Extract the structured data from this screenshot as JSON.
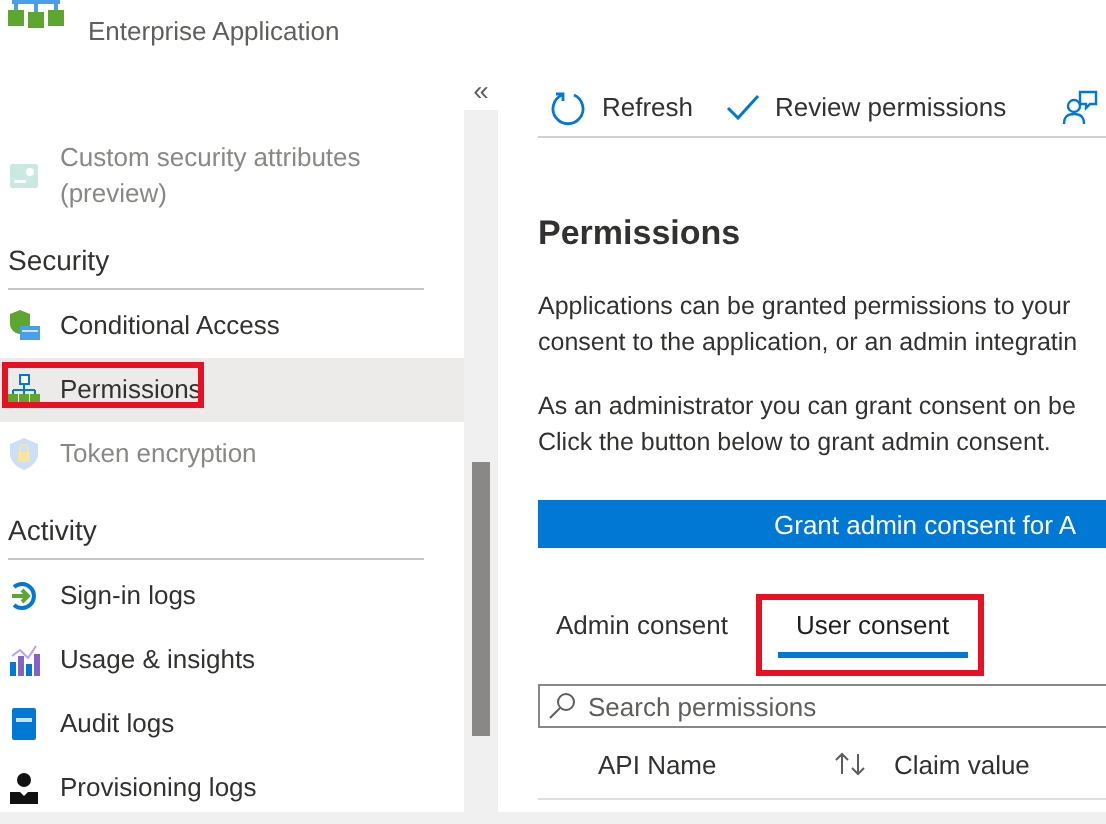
{
  "header": {
    "subtitle": "Enterprise Application"
  },
  "sidebar": {
    "collapse": "«",
    "groups": [
      {
        "items": [
          {
            "label": "Custom security attributes (preview)",
            "disabled": true,
            "selected": false,
            "highlighted": false
          }
        ]
      },
      {
        "heading": "Security",
        "items": [
          {
            "label": "Conditional Access",
            "disabled": false,
            "selected": false,
            "highlighted": false
          },
          {
            "label": "Permissions",
            "disabled": false,
            "selected": true,
            "highlighted": true
          },
          {
            "label": "Token encryption",
            "disabled": true,
            "selected": false,
            "highlighted": false
          }
        ]
      },
      {
        "heading": "Activity",
        "items": [
          {
            "label": "Sign-in logs",
            "disabled": false,
            "selected": false,
            "highlighted": false
          },
          {
            "label": "Usage & insights",
            "disabled": false,
            "selected": false,
            "highlighted": false
          },
          {
            "label": "Audit logs",
            "disabled": false,
            "selected": false,
            "highlighted": false
          },
          {
            "label": "Provisioning logs",
            "disabled": false,
            "selected": false,
            "highlighted": false
          }
        ]
      }
    ]
  },
  "toolbar": [
    {
      "label": "Refresh"
    },
    {
      "label": "Review permissions"
    }
  ],
  "page": {
    "title": "Permissions",
    "paragraphs": [
      [
        "Applications can be granted permissions to your",
        "consent to the application, or an admin integratin"
      ],
      [
        "As an administrator you can grant consent on be",
        "Click the button below to grant admin consent."
      ]
    ],
    "grant_button": "Grant admin consent for A",
    "tabs": [
      {
        "label": "Admin consent",
        "selected": false,
        "highlighted": false
      },
      {
        "label": "User consent",
        "selected": true,
        "highlighted": true
      }
    ],
    "search": {
      "placeholder": "Search permissions"
    },
    "table": {
      "columns": [
        {
          "label": "API Name"
        },
        {
          "label": "Claim value"
        }
      ]
    }
  }
}
